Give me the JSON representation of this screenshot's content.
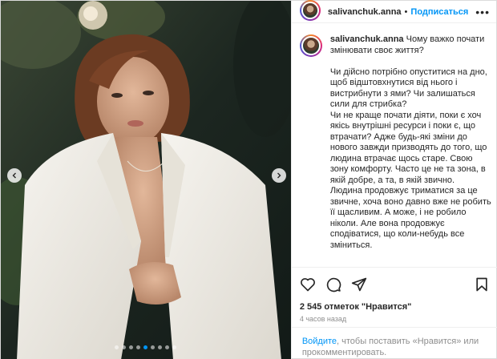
{
  "post": {
    "username": "salivanchuk.anna",
    "separator": "•",
    "follow_label": "Подписаться",
    "more_icon": "more-horizontal-icon",
    "caption": {
      "author": "salivanchuk.anna",
      "lead": "Чому важко почати змінювати своє життя?",
      "paragraphs": [
        "Чи дійсно потрібно опуститися на дно, щоб відштовхнутися від нього і вистрибнути з ями? Чи залишаться сили для стрибка?",
        "Чи не краще почати діяти, поки є хоч якісь внутрішні ресурси і поки є, що втрачати? Адже будь-які зміни до нового завжди призводять до того, що людина втрачає щось старе. Свою зону комфорту. Часто це не та зона, в якій добре, а та, в якій звично.",
        "Людина продовжує триматися за це звичне, хоча воно давно вже не робить її щасливим. А може, і не робило ніколи. Але вона продовжує сподіватися, що коли-небудь все зміниться."
      ]
    },
    "media": {
      "slide_count": 9,
      "active_slide": 4,
      "prev_icon": "chevron-left-icon",
      "next_icon": "chevron-right-icon"
    },
    "actions": {
      "like_icon": "heart-icon",
      "comment_icon": "comment-icon",
      "share_icon": "paper-plane-icon",
      "save_icon": "bookmark-icon"
    },
    "likes_text": "2 545 отметок \"Нравится\"",
    "time_text": "4 часов назад",
    "login": {
      "link": "Войдите",
      "rest": ", чтобы поставить «Нравится» или прокомментировать."
    },
    "colors": {
      "accent": "#0095f6",
      "text": "#262626",
      "muted": "#8e8e8e"
    }
  }
}
